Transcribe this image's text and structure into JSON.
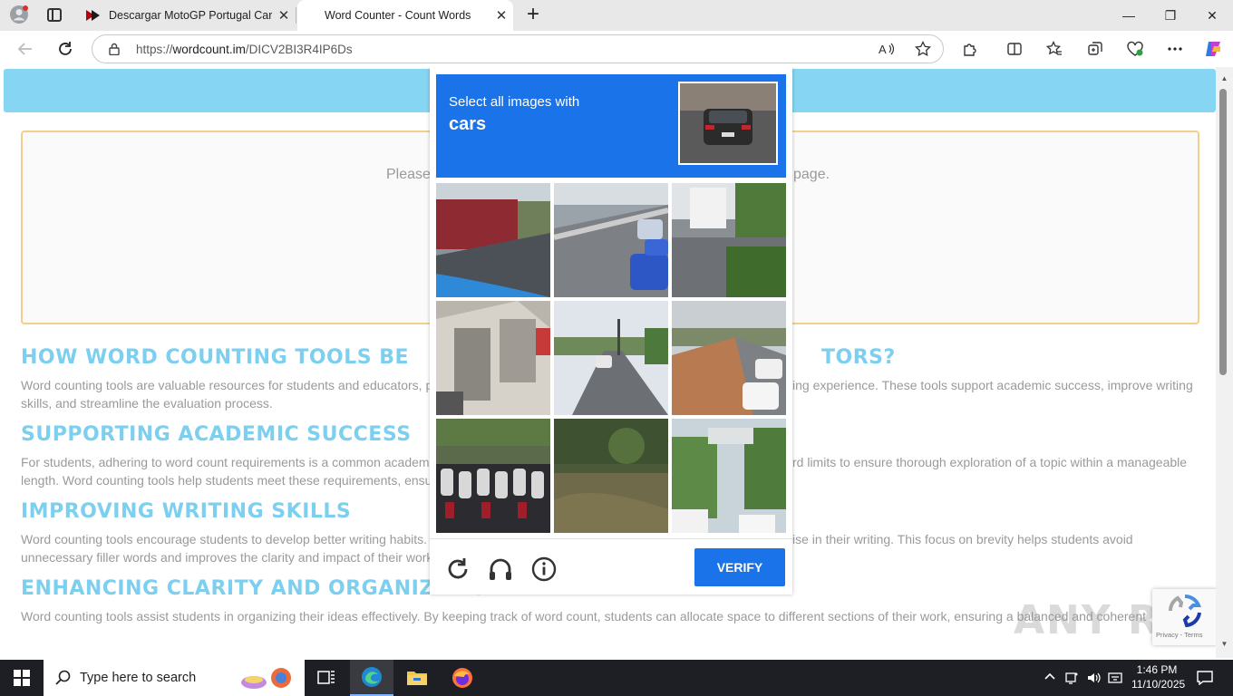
{
  "browser": {
    "tabs": [
      {
        "title": "Descargar MotoGP Portugal Carre",
        "active": false
      },
      {
        "title": "Word Counter - Count Words",
        "active": true
      }
    ],
    "new_tab_symbol": "+",
    "close_symbol": "✕",
    "address": {
      "prefix": "https://",
      "host": "wordcount.im",
      "path": "/DICV2BI3R4IP6Ds"
    },
    "window_controls": {
      "minimize": "—",
      "restore": "❐",
      "close": "✕"
    }
  },
  "page": {
    "textbox_placeholder_left": "Please",
    "textbox_placeholder_right": "page.",
    "sections": [
      {
        "heading_left": "HOW WORD COUNTING TOOLS BE",
        "heading_right": "TORS?",
        "line1_left": "Word counting tools are valuable resources for students and educators, p",
        "line1_right": "ing experience. These tools support academic success, improve writing",
        "line2": "skills, and streamline the evaluation process."
      },
      {
        "heading_left": "SUPPORTING ACADEMIC SUCCESS",
        "heading_right": "",
        "line1_left": "For students, adhering to word count requirements is a common academ",
        "line1_right": "rd limits to ensure thorough exploration of a topic within a manageable",
        "line2": "length. Word counting tools help students meet these requirements, ensu"
      },
      {
        "heading_left": "IMPROVING WRITING SKILLS",
        "heading_right": "",
        "line1_left": "Word counting tools encourage students to develop better writing habits.",
        "line1_right": "ise in their writing. This focus on brevity helps students avoid",
        "line2": "unnecessary filler words and improves the clarity and impact of their work"
      },
      {
        "heading_left": "ENHANCING CLARITY AND ORGANIZATION",
        "heading_right": "",
        "line1_left": "Word counting tools assist students in organizing their ideas effectively. By keeping track of word count, students can allocate space to different sections of their work, ensuring a balanced and coherent",
        "line1_right": "",
        "line2": ""
      }
    ]
  },
  "captcha": {
    "instruction": "Select all images with",
    "target": "cars",
    "verify_label": "VERIFY",
    "tiles": [
      "red-hedge-street",
      "highway-blue-car",
      "street-corner",
      "building-entrance",
      "road-traffic-lights",
      "road-construction-cars",
      "parked-scooters",
      "overgrown-bushes",
      "palm-trees-sign"
    ]
  },
  "badge": {
    "terms": "Privacy - Terms"
  },
  "watermark": "ANY RUN",
  "taskbar": {
    "search_placeholder": "Type here to search",
    "time": "1:46 PM",
    "date": "11/10/2025"
  }
}
